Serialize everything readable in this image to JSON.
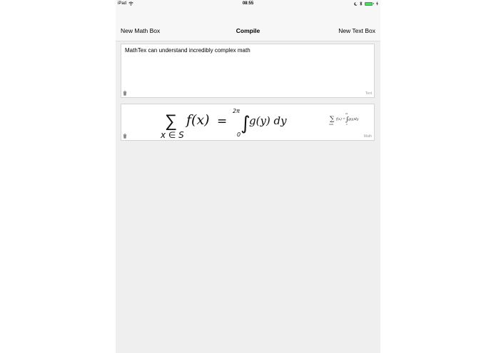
{
  "status_bar": {
    "device": "iPad",
    "time": "08:55"
  },
  "nav": {
    "left_button": "New Math Box",
    "title": "Compile",
    "right_button": "New Text Box"
  },
  "text_box": {
    "content": "MathTex can understand incredibly complex math",
    "type_label": "Text"
  },
  "math_box": {
    "type_label": "Math",
    "handwriting": {
      "summation_symbol": "∑",
      "subscript": "x ∈ S",
      "function": "f(x)",
      "equals": "=",
      "upper_limit": "2π",
      "lower_limit": "0",
      "integrand": "g(y) dy"
    },
    "rendered_formula": {
      "summation_symbol": "∑",
      "subscript": "x∈S",
      "lhs": "f(x) =",
      "upper_limit": "2π",
      "integral_symbol": "∫",
      "lower_limit": "0",
      "integrand": "g(y)dy"
    }
  },
  "colors": {
    "battery": "#4cd964",
    "background": "#efefef",
    "bar": "#f7f7f7"
  }
}
